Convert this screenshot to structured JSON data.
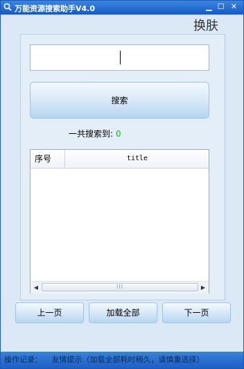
{
  "window": {
    "title": "万能资源搜索助手V4.0",
    "minimize_icon": "minimize-icon",
    "maximize_icon": "maximize-icon",
    "close_icon": "close-icon"
  },
  "skin_button": "换肤",
  "search": {
    "value": "",
    "button_label": "搜索"
  },
  "result": {
    "count_label": "一共搜索到:",
    "count_value": "0",
    "count_color": "#1fb31f"
  },
  "list": {
    "columns": [
      "序号",
      "title"
    ],
    "rows": [],
    "scroll_left_icon": "chevron-left-icon",
    "scroll_right_icon": "chevron-right-icon",
    "scroll_grip": "III"
  },
  "pager": {
    "prev_label": "上一页",
    "load_all_label": "加载全部",
    "next_label": "下一页"
  },
  "status_bar": {
    "label": "操作记录：",
    "message": "友情提示（加载全部耗时稍久，请慎重选择）"
  }
}
